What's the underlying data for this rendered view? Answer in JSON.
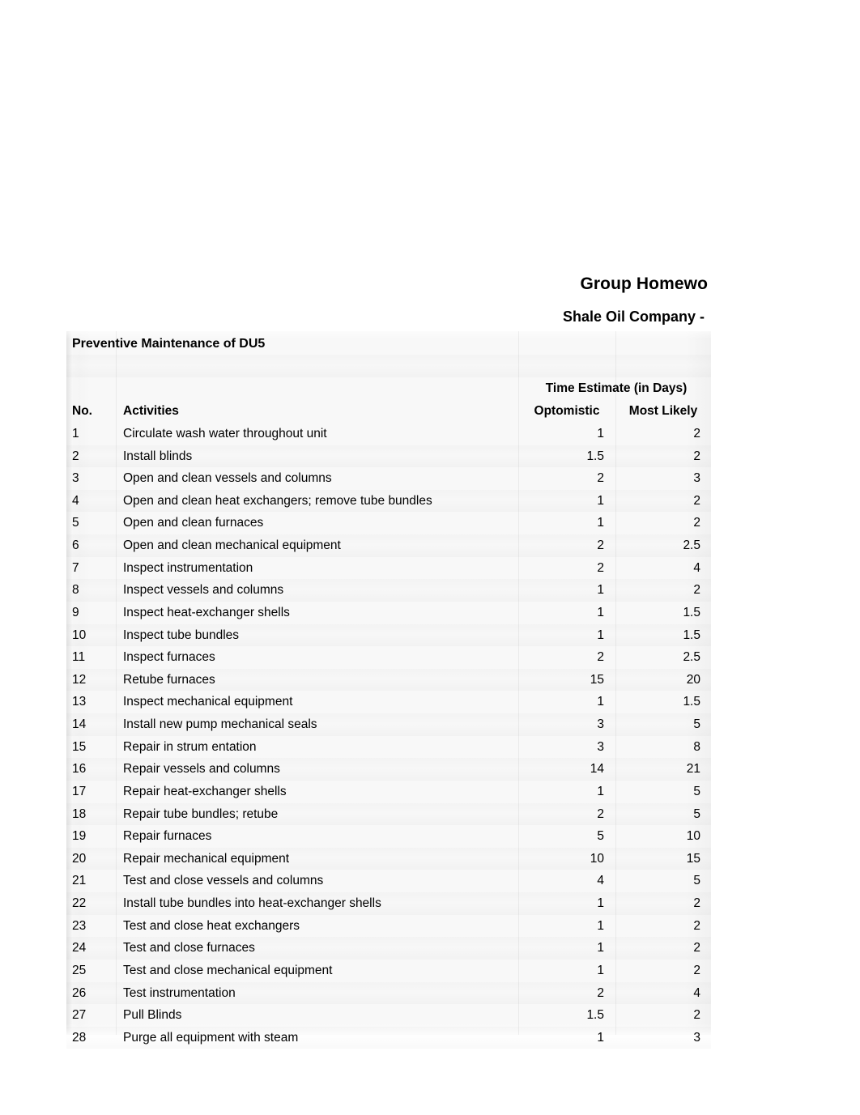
{
  "document": {
    "title": "Group Homewo",
    "subtitle": "Shale Oil Company -"
  },
  "sheet": {
    "section_title": "Preventive Maintenance of DU5",
    "group_header": "Time Estimate (in Days)",
    "columns": {
      "no": "No.",
      "activities": "Activities",
      "optimistic": "Optomistic",
      "most_likely": "Most Likely"
    },
    "rows": [
      {
        "no": "1",
        "activity": "Circulate wash water throughout unit",
        "optimistic": "1",
        "most_likely": "2"
      },
      {
        "no": "2",
        "activity": "Install blinds",
        "optimistic": "1.5",
        "most_likely": "2"
      },
      {
        "no": "3",
        "activity": "Open and clean vessels and columns",
        "optimistic": "2",
        "most_likely": "3"
      },
      {
        "no": "4",
        "activity": "Open and clean heat exchangers; remove tube bundles",
        "optimistic": "1",
        "most_likely": "2"
      },
      {
        "no": "5",
        "activity": "Open and clean furnaces",
        "optimistic": "1",
        "most_likely": "2"
      },
      {
        "no": "6",
        "activity": "Open and clean mechanical equipment",
        "optimistic": "2",
        "most_likely": "2.5"
      },
      {
        "no": "7",
        "activity": "Inspect instrumentation",
        "optimistic": "2",
        "most_likely": "4"
      },
      {
        "no": "8",
        "activity": "Inspect vessels and columns",
        "optimistic": "1",
        "most_likely": "2"
      },
      {
        "no": "9",
        "activity": "Inspect heat-exchanger shells",
        "optimistic": "1",
        "most_likely": "1.5"
      },
      {
        "no": "10",
        "activity": "Inspect tube bundles",
        "optimistic": "1",
        "most_likely": "1.5"
      },
      {
        "no": "11",
        "activity": "Inspect furnaces",
        "optimistic": "2",
        "most_likely": "2.5"
      },
      {
        "no": "12",
        "activity": "Retube furnaces",
        "optimistic": "15",
        "most_likely": "20"
      },
      {
        "no": "13",
        "activity": "Inspect mechanical equipment",
        "optimistic": "1",
        "most_likely": "1.5"
      },
      {
        "no": "14",
        "activity": "Install new  pump mechanical seals",
        "optimistic": "3",
        "most_likely": "5"
      },
      {
        "no": "15",
        "activity": "Repair in strum entation",
        "optimistic": "3",
        "most_likely": "8"
      },
      {
        "no": "16",
        "activity": "Repair vessels and columns",
        "optimistic": "14",
        "most_likely": "21"
      },
      {
        "no": "17",
        "activity": "Repair heat-exchanger shells",
        "optimistic": "1",
        "most_likely": "5"
      },
      {
        "no": "18",
        "activity": "Repair tube bundles; retube",
        "optimistic": "2",
        "most_likely": "5"
      },
      {
        "no": "19",
        "activity": "Repair furnaces",
        "optimistic": "5",
        "most_likely": "10"
      },
      {
        "no": "20",
        "activity": "Repair mechanical equipment",
        "optimistic": "10",
        "most_likely": "15"
      },
      {
        "no": "21",
        "activity": "Test and close vessels and columns",
        "optimistic": "4",
        "most_likely": "5"
      },
      {
        "no": "22",
        "activity": "Install tube bundles into heat-exchanger shells",
        "optimistic": "1",
        "most_likely": "2"
      },
      {
        "no": "23",
        "activity": "Test and close heat exchangers",
        "optimistic": "1",
        "most_likely": "2"
      },
      {
        "no": "24",
        "activity": "Test and close furnaces",
        "optimistic": "1",
        "most_likely": "2"
      },
      {
        "no": "25",
        "activity": "Test and close mechanical equipment",
        "optimistic": "1",
        "most_likely": "2"
      },
      {
        "no": "26",
        "activity": "Test instrumentation",
        "optimistic": "2",
        "most_likely": "4"
      },
      {
        "no": "27",
        "activity": "Pull Blinds",
        "optimistic": "1.5",
        "most_likely": "2"
      },
      {
        "no": "28",
        "activity": "Purge all equipment with steam",
        "optimistic": "1",
        "most_likely": "3"
      }
    ]
  }
}
